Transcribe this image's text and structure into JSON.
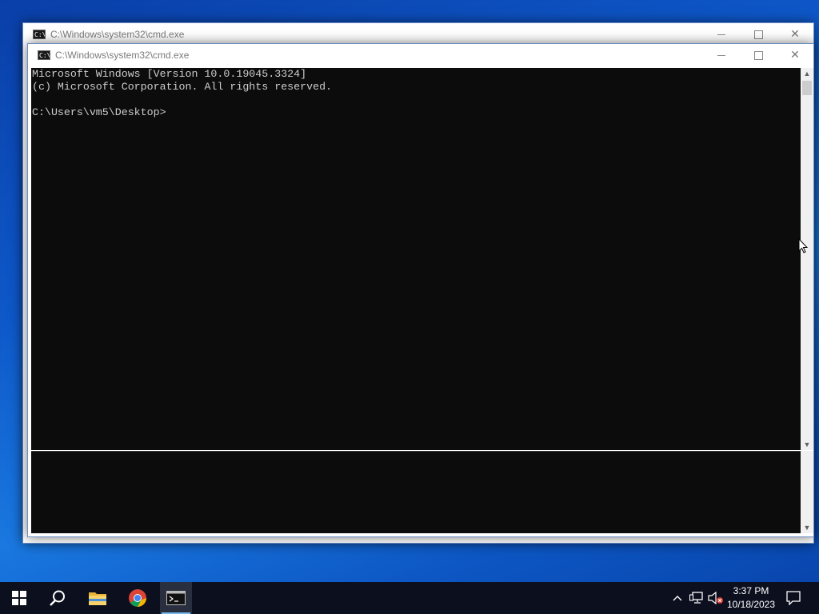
{
  "back_window": {
    "title": "C:\\Windows\\system32\\cmd.exe"
  },
  "front_window": {
    "title": "C:\\Windows\\system32\\cmd.exe",
    "console_lines": [
      "Microsoft Windows [Version 10.0.19045.3324]",
      "(c) Microsoft Corporation. All rights reserved.",
      "",
      "C:\\Users\\vm5\\Desktop>"
    ]
  },
  "taskbar": {
    "apps": [
      {
        "icon": "windows-start-icon",
        "active": false
      },
      {
        "icon": "search-icon",
        "active": false
      },
      {
        "icon": "file-explorer-icon",
        "active": false
      },
      {
        "icon": "chrome-icon",
        "active": false
      },
      {
        "icon": "command-prompt-icon",
        "active": true
      }
    ],
    "tray_icons": [
      "chevron-up-icon",
      "network-icon",
      "volume-muted-icon",
      "notification-icon"
    ],
    "clock_time": "3:37 PM",
    "clock_date": "10/18/2023"
  },
  "colors": {
    "console_bg": "#0c0c0c",
    "console_fg": "#cccccc",
    "taskbar_bg": "#0b0f1e",
    "accent": "#76b9ed"
  }
}
